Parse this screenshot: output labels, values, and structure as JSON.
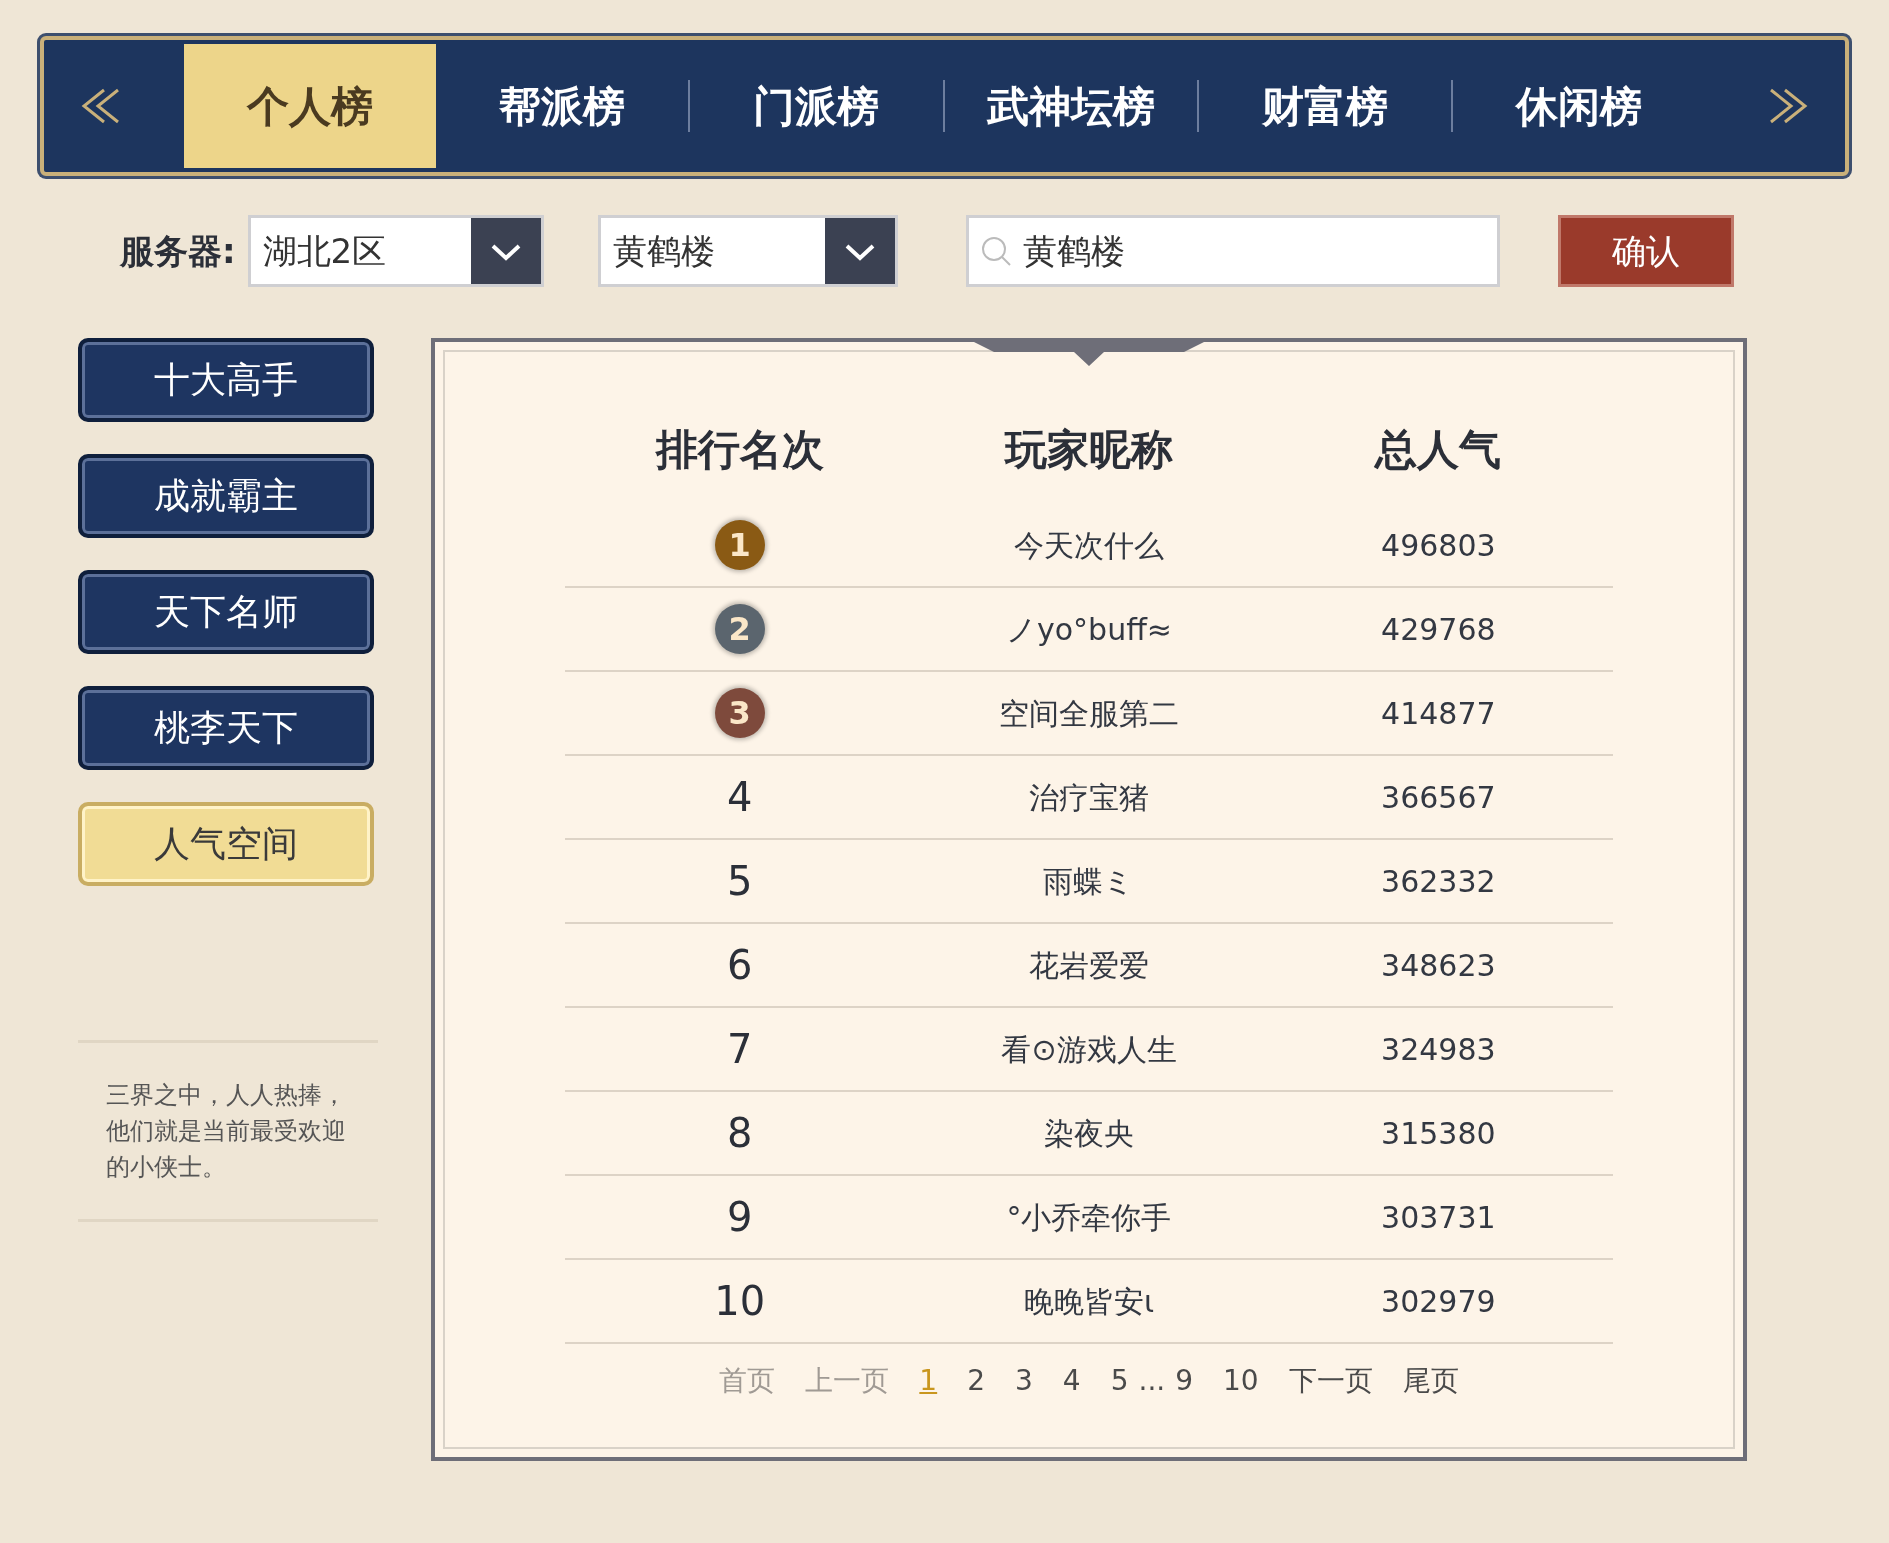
{
  "tabs": [
    {
      "label": "个人榜",
      "selected": true
    },
    {
      "label": "帮派榜",
      "selected": false
    },
    {
      "label": "门派榜",
      "selected": false
    },
    {
      "label": "武神坛榜",
      "selected": false
    },
    {
      "label": "财富榜",
      "selected": false
    },
    {
      "label": "休闲榜",
      "selected": false
    }
  ],
  "filters": {
    "server_label": "服务器:",
    "server_value": "湖北2区",
    "group_value": "黄鹤楼",
    "search_value": "黄鹤楼",
    "confirm": "确认"
  },
  "sidebar": {
    "items": [
      {
        "label": "十大高手",
        "selected": false
      },
      {
        "label": "成就霸主",
        "selected": false
      },
      {
        "label": "天下名师",
        "selected": false
      },
      {
        "label": "桃李天下",
        "selected": false
      },
      {
        "label": "人气空间",
        "selected": true
      }
    ],
    "description": "三界之中，人人热捧，他们就是当前最受欢迎的小侠士。"
  },
  "table": {
    "columns": [
      "排行名次",
      "玩家昵称",
      "总人气"
    ],
    "rows": [
      {
        "rank": {
          "kind": "medal",
          "text": "1",
          "color": "#8a5a14"
        },
        "name": "今天次什么",
        "popularity": "496803"
      },
      {
        "rank": {
          "kind": "medal",
          "text": "2",
          "color": "#5b656e"
        },
        "name": "ノyo°buff≈",
        "popularity": "429768"
      },
      {
        "rank": {
          "kind": "medal",
          "text": "3",
          "color": "#7e4a3c"
        },
        "name": "空间全服第二",
        "popularity": "414877"
      },
      {
        "rank": {
          "kind": "number",
          "text": "4"
        },
        "name": "治疗宝猪",
        "popularity": "366567"
      },
      {
        "rank": {
          "kind": "number",
          "text": "5"
        },
        "name": "雨蝶ミ",
        "popularity": "362332"
      },
      {
        "rank": {
          "kind": "number",
          "text": "6"
        },
        "name": "花岩爱爱",
        "popularity": "348623"
      },
      {
        "rank": {
          "kind": "number",
          "text": "7"
        },
        "name": "看⊙游戏人生",
        "popularity": "324983"
      },
      {
        "rank": {
          "kind": "number",
          "text": "8"
        },
        "name": "染夜央",
        "popularity": "315380"
      },
      {
        "rank": {
          "kind": "number",
          "text": "9"
        },
        "name": "°小乔牵你手",
        "popularity": "303731"
      },
      {
        "rank": {
          "kind": "number",
          "text": "10"
        },
        "name": "晚晚皆安ι",
        "popularity": "302979"
      }
    ]
  },
  "pagination": [
    {
      "kind": "link",
      "label": "首页",
      "disabled": true,
      "selected": false
    },
    {
      "kind": "link",
      "label": "上一页",
      "disabled": true,
      "selected": false
    },
    {
      "kind": "page",
      "label": "1",
      "selected": true
    },
    {
      "kind": "page",
      "label": "2",
      "selected": false
    },
    {
      "kind": "page",
      "label": "3",
      "selected": false
    },
    {
      "kind": "page",
      "label": "4",
      "selected": false
    },
    {
      "kind": "page",
      "label": "5",
      "selected": false
    },
    {
      "kind": "ellipsis",
      "label": "...",
      "selected": false
    },
    {
      "kind": "page",
      "label": "9",
      "selected": false
    },
    {
      "kind": "page",
      "label": "10",
      "selected": false
    },
    {
      "kind": "link",
      "label": "下一页",
      "disabled": false,
      "selected": false
    },
    {
      "kind": "link",
      "label": "尾页",
      "disabled": false,
      "selected": false
    }
  ]
}
